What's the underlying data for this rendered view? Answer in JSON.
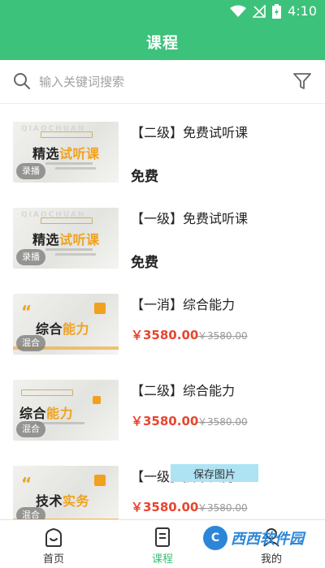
{
  "status_bar": {
    "time": "4:10",
    "icons": [
      "wifi-icon",
      "signal-off-icon",
      "battery-charging-icon"
    ]
  },
  "header": {
    "title": "课程"
  },
  "search": {
    "placeholder": "输入关键词搜索",
    "value": ""
  },
  "courses": [
    {
      "thumb_text": "精选试听课",
      "tag": "录播",
      "title": "【二级】免费试听课",
      "price": "免费",
      "old_price": ""
    },
    {
      "thumb_text": "精选试听课",
      "tag": "录播",
      "title": "【一级】免费试听课",
      "price": "免费",
      "old_price": ""
    },
    {
      "thumb_text": "综合能力",
      "tag": "混合",
      "title": "【一消】综合能力",
      "price": "￥3580.00",
      "old_price": "￥3580.00"
    },
    {
      "thumb_text": "综合能力",
      "tag": "混合",
      "title": "【二级】综合能力",
      "price": "￥3580.00",
      "old_price": "￥3580.00"
    },
    {
      "thumb_text": "技术实务",
      "tag": "混合",
      "title": "【一级】技术实务",
      "price": "￥3580.00",
      "old_price": "￥3580.00"
    }
  ],
  "popup": {
    "label": "保存图片"
  },
  "bottom_nav": [
    {
      "label": "首页",
      "icon": "home-icon",
      "active": false
    },
    {
      "label": "课程",
      "icon": "course-icon",
      "active": true
    },
    {
      "label": "我的",
      "icon": "profile-icon",
      "active": false
    }
  ],
  "watermark": {
    "text": "西西软件园"
  },
  "colors": {
    "brand": "#3cc27a",
    "price": "#e8452f",
    "accent": "#f0a21e"
  }
}
